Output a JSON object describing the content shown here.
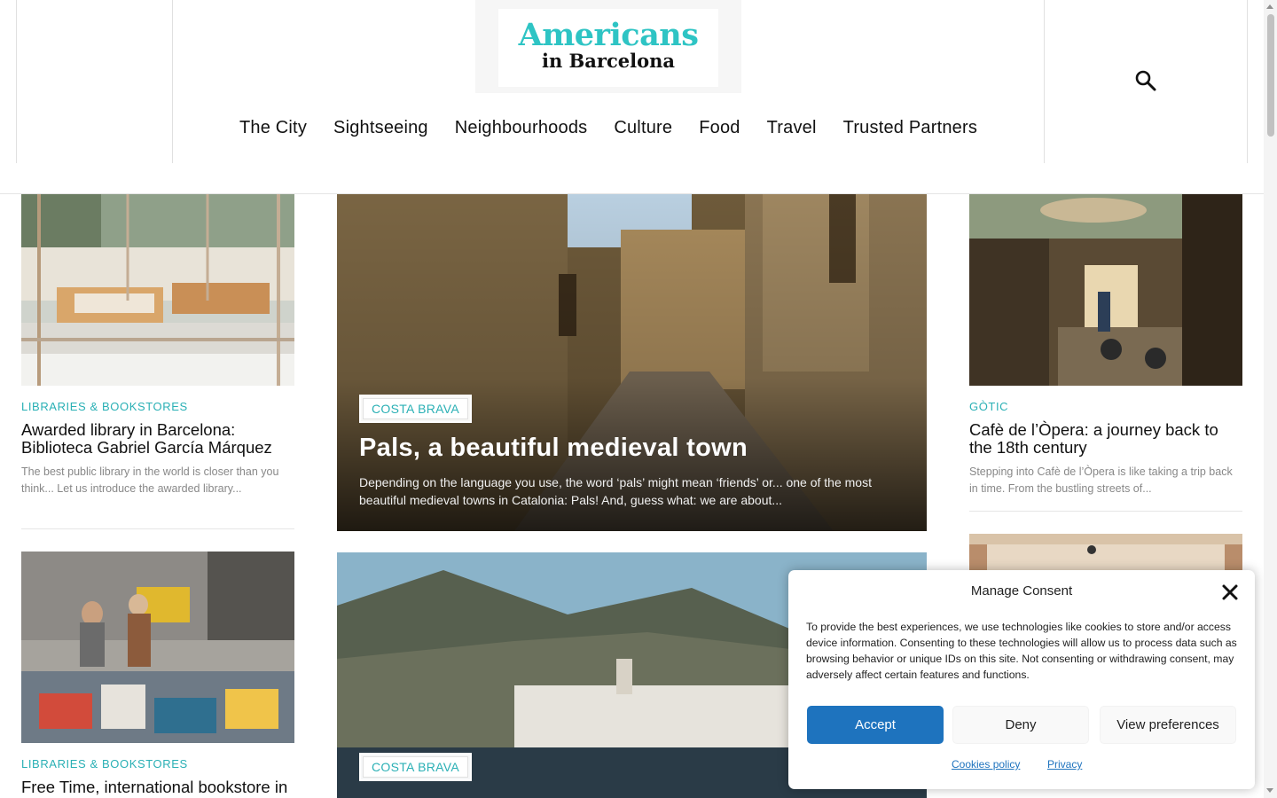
{
  "site": {
    "logo_line1": "Americans",
    "logo_line2": "in Barcelona"
  },
  "nav": {
    "items": [
      "The City",
      "Sightseeing",
      "Neighbourhoods",
      "Culture",
      "Food",
      "Travel",
      "Trusted Partners"
    ]
  },
  "left_column": [
    {
      "category": "LIBRARIES & BOOKSTORES",
      "title": "Awarded library in Barcelona: Biblioteca Gabriel García Márquez",
      "excerpt": "The best public library in the world is closer than you think... Let us introduce the awarded library..."
    },
    {
      "category": "LIBRARIES & BOOKSTORES",
      "title": "Free Time, international bookstore in Barcelona"
    }
  ],
  "center_column": [
    {
      "category": "COSTA BRAVA",
      "title": "Pals, a beautiful medieval town",
      "excerpt": "Depending on the language you use, the word ‘pals’ might mean ‘friends’ or... one of the most beautiful medieval towns in Catalonia: Pals! And, guess what: we are about..."
    },
    {
      "category": "COSTA BRAVA"
    }
  ],
  "right_column": [
    {
      "category": "GÒTIC",
      "title": "Cafè de l’Òpera: a journey back to the 18th century",
      "excerpt": "Stepping into Cafè de l’Òpera is like taking a trip back in time. From the bustling streets of..."
    }
  ],
  "consent": {
    "title": "Manage Consent",
    "text": "To provide the best experiences, we use technologies like cookies to store and/or access device information. Consenting to these technologies will allow us to process data such as browsing behavior or unique IDs on this site. Not consenting or withdrawing consent, may adversely affect certain features and functions.",
    "accept_label": "Accept",
    "deny_label": "Deny",
    "preferences_label": "View preferences",
    "cookies_policy_label": "Cookies policy",
    "privacy_label": "Privacy"
  },
  "colors": {
    "accent": "#2ab0b5",
    "accept_button": "#1e73be"
  },
  "icons": {
    "search": "search-icon",
    "close": "close-icon"
  }
}
